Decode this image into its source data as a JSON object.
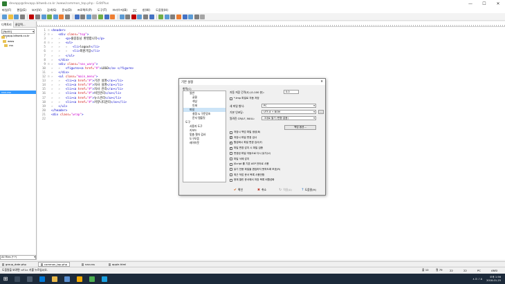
{
  "window": {
    "title": "devapp@devapp.bitweb.co.kr /www/common_top.php - EditPlus",
    "minimize_glyph": "—",
    "maximize_glyph": "☐",
    "close_glyph": "✕"
  },
  "menu": [
    "파일(F)",
    "편집(E)",
    "보기(V)",
    "검색(S)",
    "문서(D)",
    "프로젝트(P)",
    "도구(T)",
    "브라우저(B)",
    "ZC",
    "창(W)",
    "도움말(H)"
  ],
  "left_panel": {
    "tabs": [
      "디렉토리",
      "클립텍..."
    ],
    "ftp_select": "[ftp00] devapp.bitweb.co.kr",
    "tree": [
      {
        "label": "/",
        "kind": "folder"
      },
      {
        "label": "www",
        "kind": "folder"
      },
      {
        "label": "css",
        "kind": "folder"
      }
    ],
    "selected_file": "nav.css",
    "filter": "All Files (*.*)"
  },
  "editor": {
    "lines": [
      {
        "n": "1",
        "fold": "⊟",
        "indent": "",
        "parts": [
          [
            "tag",
            "<header>"
          ]
        ]
      },
      {
        "n": "2",
        "fold": "⊟",
        "indent": "»   ",
        "parts": [
          [
            "tag",
            "<div "
          ],
          [
            "attr",
            "class="
          ],
          [
            "str",
            "\"top\""
          ],
          [
            "tag",
            ">"
          ]
        ]
      },
      {
        "n": "3",
        "fold": "",
        "indent": "»   »   ",
        "parts": [
          [
            "tag",
            "<p>"
          ],
          [
            "txt",
            "홍길동님 환영합니다"
          ],
          [
            "tag",
            "</p>"
          ]
        ]
      },
      {
        "n": "4",
        "fold": "⊟",
        "indent": "»   »   ",
        "parts": [
          [
            "tag",
            "<ul>"
          ]
        ]
      },
      {
        "n": "5",
        "fold": "",
        "indent": "»   »   »   ",
        "parts": [
          [
            "tag",
            "<li>"
          ],
          [
            "txt",
            "logout"
          ],
          [
            "tag",
            "</li>"
          ]
        ]
      },
      {
        "n": "6",
        "fold": "",
        "indent": "»   »   »   ",
        "parts": [
          [
            "tag",
            "<li>"
          ],
          [
            "txt",
            "회원가입"
          ],
          [
            "tag",
            "</li>"
          ]
        ]
      },
      {
        "n": "7",
        "fold": "",
        "indent": "»   »   ",
        "parts": [
          [
            "tag",
            "</ul>"
          ]
        ]
      },
      {
        "n": "8",
        "fold": "",
        "indent": "»   ",
        "parts": [
          [
            "tag",
            "</div>"
          ]
        ]
      },
      {
        "n": "9",
        "fold": "⊟",
        "indent": "»   ",
        "parts": [
          [
            "tag",
            "<div "
          ],
          [
            "attr",
            "class="
          ],
          [
            "str",
            "\"nav_warp\""
          ],
          [
            "tag",
            ">"
          ]
        ]
      },
      {
        "n": "10",
        "fold": "",
        "indent": "»   »   ",
        "parts": [
          [
            "tag",
            "<figure>"
          ],
          [
            "tag",
            "<a "
          ],
          [
            "attr",
            "href="
          ],
          [
            "str",
            "\"#\""
          ],
          [
            "tag",
            ">"
          ],
          [
            "txt",
            "LOGO"
          ],
          [
            "tag",
            "</a>"
          ],
          [
            "tag",
            " </figure>"
          ]
        ]
      },
      {
        "n": "11",
        "fold": "",
        "indent": "»   ",
        "parts": [
          [
            "tag",
            "</div>"
          ]
        ]
      },
      {
        "n": "12",
        "fold": "⊟",
        "indent": "»   ",
        "parts": [
          [
            "tag",
            "<ul "
          ],
          [
            "attr",
            "class="
          ],
          [
            "str",
            "\"main_menu\""
          ],
          [
            "tag",
            ">"
          ]
        ]
      },
      {
        "n": "13",
        "fold": "",
        "indent": "»   »   ",
        "parts": [
          [
            "tag",
            "<li>"
          ],
          [
            "tag",
            "<a "
          ],
          [
            "attr",
            "href="
          ],
          [
            "str",
            "\"#\""
          ],
          [
            "tag",
            ">"
          ],
          [
            "txt",
            "기관 설명"
          ],
          [
            "tag",
            "</a></li>"
          ]
        ]
      },
      {
        "n": "14",
        "fold": "",
        "indent": "»   »   ",
        "parts": [
          [
            "tag",
            "<li>"
          ],
          [
            "tag",
            "<a "
          ],
          [
            "attr",
            "href="
          ],
          [
            "str",
            "\"#\""
          ],
          [
            "tag",
            ">"
          ],
          [
            "txt",
            "자사 설명"
          ],
          [
            "tag",
            "</a></li>"
          ]
        ]
      },
      {
        "n": "15",
        "fold": "",
        "indent": "»   »   ",
        "parts": [
          [
            "tag",
            "<li>"
          ],
          [
            "tag",
            "<a "
          ],
          [
            "attr",
            "href="
          ],
          [
            "str",
            "\"#\""
          ],
          [
            "tag",
            ">"
          ],
          [
            "txt",
            "자사 관리"
          ],
          [
            "tag",
            "</a></li>"
          ]
        ]
      },
      {
        "n": "16",
        "fold": "",
        "indent": "»   »   ",
        "parts": [
          [
            "tag",
            "<li>"
          ],
          [
            "tag",
            "<a "
          ],
          [
            "attr",
            "href="
          ],
          [
            "str",
            "\"#\""
          ],
          [
            "tag",
            ">"
          ],
          [
            "txt",
            "비전관리"
          ],
          [
            "tag",
            "</a></li>"
          ]
        ]
      },
      {
        "n": "17",
        "fold": "",
        "indent": "»   »   ",
        "parts": [
          [
            "tag",
            "<li>"
          ],
          [
            "tag",
            "<a "
          ],
          [
            "attr",
            "href="
          ],
          [
            "str",
            "\"#\""
          ],
          [
            "tag",
            ">"
          ],
          [
            "txt",
            "뉴스관리"
          ],
          [
            "tag",
            "</a></li>"
          ]
        ]
      },
      {
        "n": "18",
        "fold": "",
        "indent": "»   »   ",
        "parts": [
          [
            "tag",
            "<li>"
          ],
          [
            "tag",
            "<a "
          ],
          [
            "attr",
            "href="
          ],
          [
            "str",
            "\"#\""
          ],
          [
            "tag",
            ">"
          ],
          [
            "txt",
            "커뮤니티관리"
          ],
          [
            "tag",
            "</a></li>"
          ]
        ]
      },
      {
        "n": "19",
        "fold": "",
        "indent": "»   ",
        "parts": [
          [
            "tag",
            "</ul>"
          ]
        ]
      },
      {
        "n": "20",
        "fold": "",
        "indent": "",
        "parts": [
          [
            "tag",
            "</header>"
          ]
        ]
      },
      {
        "n": "21",
        "fold": "",
        "indent": "",
        "parts": [
          [
            "tag",
            "<div "
          ],
          [
            "attr",
            "class="
          ],
          [
            "str",
            "\"wrap\""
          ],
          [
            "tag",
            "> "
          ]
        ]
      },
      {
        "n": "22",
        "fold": "",
        "indent": "",
        "parts": []
      }
    ]
  },
  "doc_tabs": [
    "group_date.php",
    "common_top.php",
    "nav.css",
    "apple.html"
  ],
  "active_doc_tab": 1,
  "status": {
    "message": "도움말을 보려면 <F1> 키를 누르십시오.",
    "cells": [
      "줄 10",
      "컬 79",
      "22",
      "22",
      "PC",
      "ANSI"
    ]
  },
  "taskbar": {
    "start_glyph": "⊞",
    "clock_time": "오후 1:56",
    "clock_date": "2018-01-25",
    "tray_text": "∧  ⊡  ♪  A"
  },
  "dialog": {
    "title": "기본 설정",
    "close_glyph": "✕",
    "categories_header": "항목(C)",
    "categories": [
      {
        "label": "일반",
        "level": 1
      },
      {
        "label": "글꼴",
        "level": 2
      },
      {
        "label": "색상",
        "level": 2
      },
      {
        "label": "인쇄",
        "level": 2
      },
      {
        "label": "파일",
        "level": 1,
        "selected": true
      },
      {
        "label": "설정 & 구문강조",
        "level": 2
      },
      {
        "label": "문서 템플릿",
        "level": 2
      },
      {
        "label": "도구",
        "level": 0
      },
      {
        "label": "사용자 도구",
        "level": 1
      },
      {
        "label": "키보드",
        "level": 1
      },
      {
        "label": "맞춤 철자 검사",
        "level": 1
      },
      {
        "label": "도구모음",
        "level": 1
      },
      {
        "label": "레이아웃",
        "level": 1
      }
    ],
    "autosave_label": "자동 저장 간격(S) (0-100 분):",
    "autosave_value": "0.0",
    "tmp_label": "*.tmp 파일로 자동 저장",
    "newfile_label": "새 파일 형식:",
    "newfile_value": "PC",
    "encoding_label": "기본 인코딩:",
    "encoding_value": "UTF-8 + BOM",
    "encoding_more": "...",
    "crlf_label": "알려진 CR/LF, NULL:",
    "crlf_value": "그대로 열기 (변환 없음)",
    "backup_button": "백업 옵션...",
    "checkboxes": [
      {
        "label": "저장시 백업 파일 생성(B)",
        "checked": false
      },
      {
        "label": "저장시 파일 변경 검사",
        "checked": true
      },
      {
        "label": "활성화시 파일 변경 검사(F)",
        "checked": true
      },
      {
        "label": "파일 변경 감지 시 파일 검증",
        "checked": true
      },
      {
        "label": "변경된 파일 자동으로 다시 읽기(U)",
        "checked": false
      },
      {
        "label": "파일 삭제 감지",
        "checked": false
      },
      {
        "label": "JScript 를 기본 ASP 언어로 사용",
        "checked": false
      },
      {
        "label": "읽기 전용 파일을 편집하지 못하도록 보호(R)",
        "checked": false
      },
      {
        "label": "최근 작업 문서 목록 사용안함",
        "checked": false
      },
      {
        "label": "현재 열린 문서에서 저장 목록 비활성화",
        "checked": false
      }
    ],
    "ok": "확인",
    "cancel": "취소",
    "apply": "적용(A)",
    "help": "도움말(H)",
    "ok_icon": "✔",
    "cancel_icon": "✖",
    "apply_icon": "↻",
    "help_icon": "?",
    "check_glyph": "✓"
  },
  "colors": {
    "accent": "#3399ff",
    "folder": "#e8c253",
    "taskbar": "#1c2a3a"
  }
}
